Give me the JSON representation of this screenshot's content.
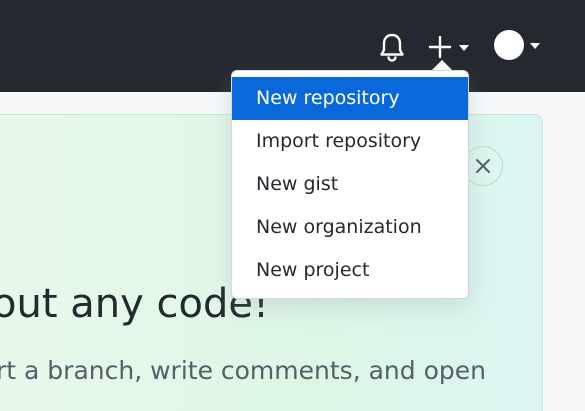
{
  "header": {
    "icons": {
      "notifications": "bell-icon",
      "create": "plus-icon",
      "create_caret": "chevron-down-icon",
      "avatar_caret": "chevron-down-icon"
    },
    "colors": {
      "background": "#24292f",
      "icon": "#ffffff"
    }
  },
  "create_menu": {
    "items": [
      {
        "label": "New repository",
        "active": true
      },
      {
        "label": "Import repository",
        "active": false
      },
      {
        "label": "New gist",
        "active": false
      },
      {
        "label": "New organization",
        "active": false
      },
      {
        "label": "New project",
        "active": false
      }
    ],
    "colors": {
      "active_background": "#0969da",
      "active_text": "#ffffff",
      "text": "#24292f"
    }
  },
  "banner": {
    "heading": "out any code!",
    "body": "rt a branch, write comments, and open",
    "close_icon": "close-icon",
    "colors": {
      "background": "#ddf7e6",
      "heading": "#24292f",
      "body": "#57606a"
    }
  }
}
